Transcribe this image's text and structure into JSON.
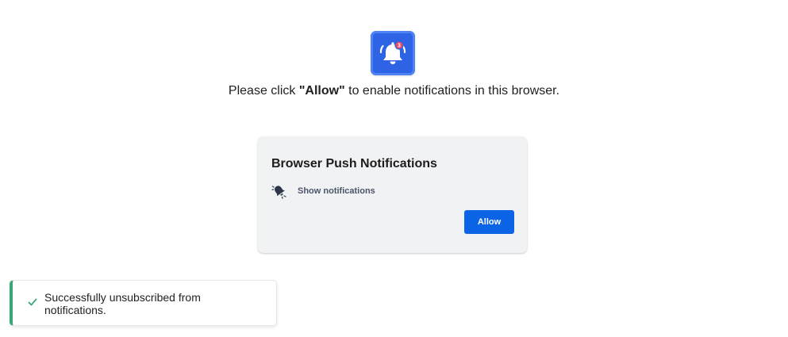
{
  "header": {
    "icon": "bell-notification-icon",
    "badge_count": "3",
    "prompt_before": "Please click ",
    "prompt_emphasis": "\"Allow\"",
    "prompt_after": " to enable notifications in this browser."
  },
  "dialog": {
    "title": "Browser Push Notifications",
    "permission_icon": "bell-icon",
    "permission_label": "Show notifications",
    "allow_label": "Allow"
  },
  "toast": {
    "icon": "check-icon",
    "message": "Successfully unsubscribed from notifications."
  },
  "colors": {
    "icon_bg": "#2f63e6",
    "badge": "#ef4660",
    "allow_button": "#0b63e5",
    "toast_accent": "#3aa876",
    "card_bg": "#f1f2f4"
  }
}
